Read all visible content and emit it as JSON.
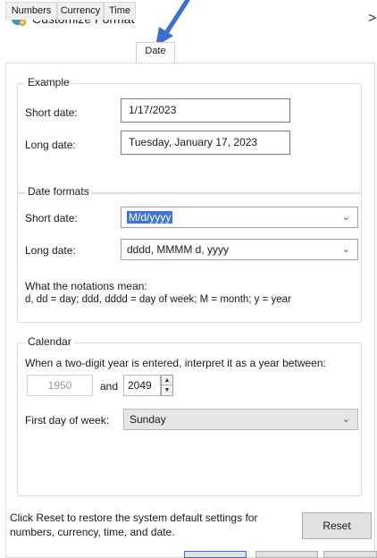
{
  "window": {
    "title": "Customize Format",
    "close_glyph": ">",
    "app_icon": "globe-settings-icon"
  },
  "tabs": [
    {
      "label": "Numbers",
      "active": false
    },
    {
      "label": "Currency",
      "active": false
    },
    {
      "label": "Time",
      "active": false
    },
    {
      "label": "Date",
      "active": true
    }
  ],
  "example": {
    "legend": "Example",
    "short_label": "Short date:",
    "short_value": "1/17/2023",
    "long_label": "Long date:",
    "long_value": "Tuesday, January 17, 2023"
  },
  "formats": {
    "legend": "Date formats",
    "short_label": "Short date:",
    "short_value": "M/d/yyyy",
    "long_label": "Long date:",
    "long_value": "dddd, MMMM d, yyyy",
    "notation_title": "What the notations mean:",
    "notation_text": "d, dd = day;  ddd, dddd = day of week;  M = month;  y = year"
  },
  "calendar": {
    "legend": "Calendar",
    "two_digit_text": "When a two-digit year is entered, interpret it as a year between:",
    "year_start": "1950",
    "and_label": "and",
    "year_end": "2049",
    "first_day_label": "First day of week:",
    "first_day_value": "Sunday"
  },
  "footer": {
    "reset_text_line1": "Click Reset to restore the system default settings for",
    "reset_text_line2": "numbers, currency, time, and date.",
    "reset_button": "Reset"
  },
  "annotation": {
    "arrow_color": "#3a6fd0"
  }
}
